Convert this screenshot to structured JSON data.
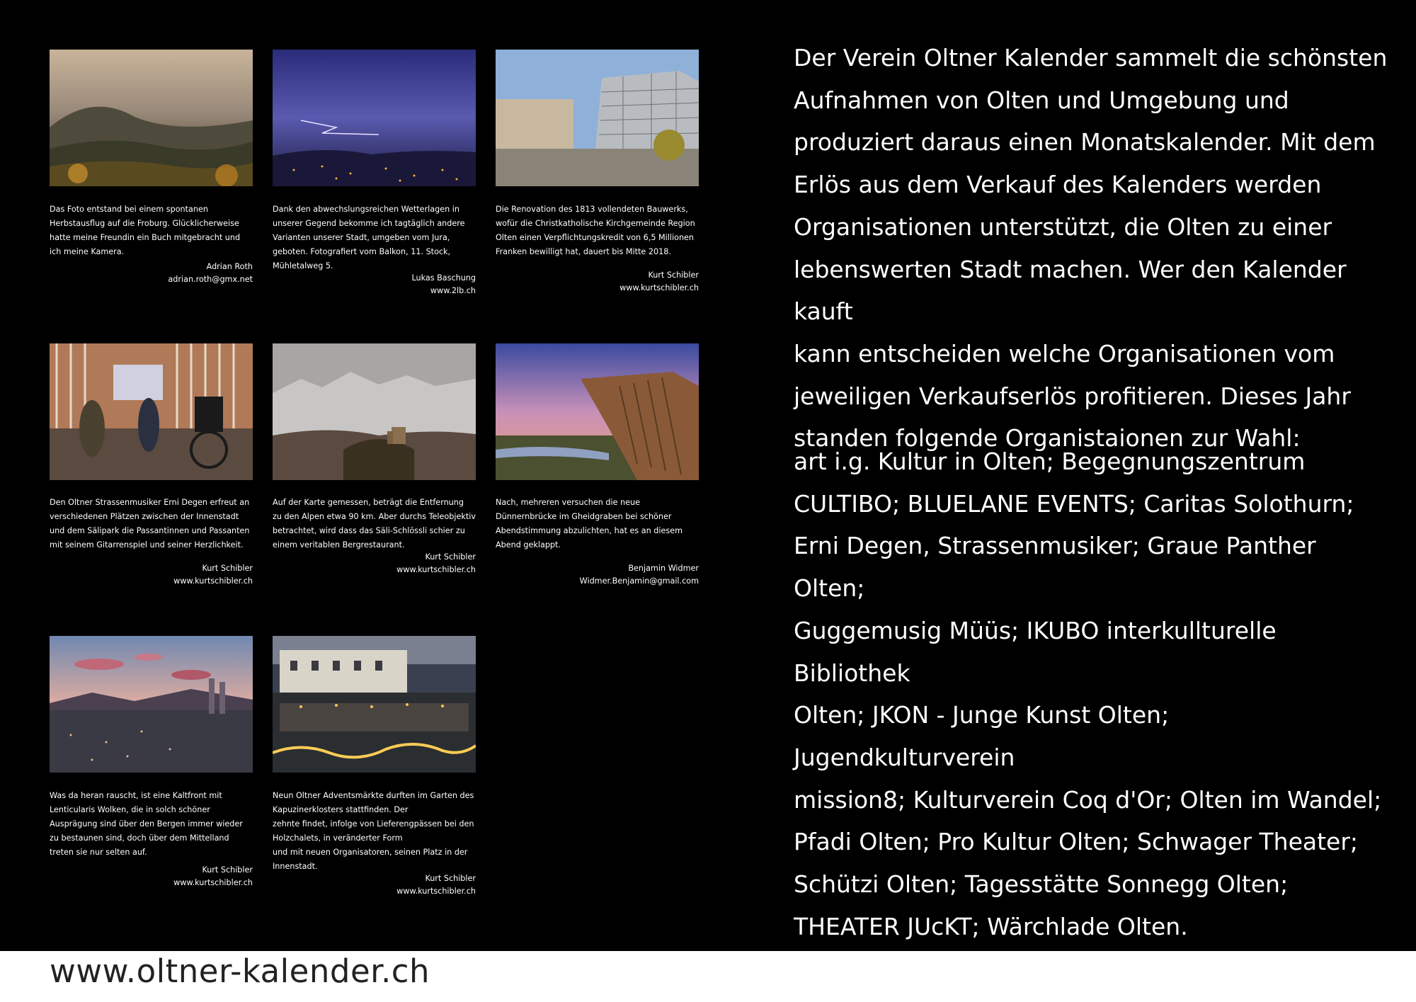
{
  "photos": [
    {
      "text": "Das Foto entstand bei einem spontanen\nHerbstausflug auf die Froburg. Glücklicherweise\nhatte meine Freundin ein Buch mitgebracht und\nich meine Kamera.",
      "author": "Adrian Roth",
      "contact": "adrian.roth@gmx.net"
    },
    {
      "text": "Dank den abwechslungsreichen Wetterlagen in\nunserer Gegend bekomme ich tagtäglich andere\nVarianten unserer Stadt, umgeben vom Jura,\ngeboten. Fotografiert vom Balkon, 11. Stock,\nMühletalweg 5.",
      "author": "Lukas Baschung",
      "contact": "www.2lb.ch"
    },
    {
      "text": "Die Renovation des 1813 vollendeten Bauwerks,\nwofür die Christkatholische Kirchgemeinde Region\nOlten einen Verpflichtungskredit von 6,5 Millionen\nFranken bewilligt hat, dauert  bis Mitte 2018.",
      "author": "Kurt Schibler",
      "contact": "www.kurtschibler.ch"
    },
    {
      "text": "Den Oltner Strassenmusiker Erni Degen erfreut an\nverschiedenen Plätzen zwischen der Innenstadt\nund dem Sälipark die Passantinnen und Passanten\nmit seinem Gitarrenspiel und seiner Herzlichkeit.",
      "author": "Kurt Schibler",
      "contact": "www.kurtschibler.ch"
    },
    {
      "text": "Auf der Karte gemessen, beträgt die Entfernung\nzu den Alpen etwa 90 km. Aber durchs Teleobjektiv\nbetrachtet, wird dass das Säli-Schlössli schier zu\neinem veritablen Bergrestaurant.",
      "author": "Kurt Schibler",
      "contact": "www.kurtschibler.ch"
    },
    {
      "text": "Nach, mehreren versuchen die neue\nDünnernbrücke im Gheidgraben bei schöner\nAbendstimmung abzulichten, hat es an diesem\nAbend geklappt.",
      "author": "Benjamin Widmer",
      "contact": "Widmer.Benjamin@gmail.com"
    },
    {
      "text": "Was da heran rauscht, ist eine Kaltfront mit\nLenticularis Wolken, die in solch schöner\nAusprägung sind über den Bergen immer wieder\nzu bestaunen sind, doch über dem Mittelland\ntreten sie nur selten auf.",
      "author": "Kurt Schibler",
      "contact": "www.kurtschibler.ch"
    },
    {
      "text": "Neun Oltner Adventsmärkte durften im Garten des\nKapuzinerklosters stattfinden. Der\nzehnte findet, infolge von Lieferengpässen bei den\nHolzchalets, in veränderter Form\nund mit neuen Organisatoren, seinen Platz in der\nInnenstadt.",
      "author": "Kurt Schibler",
      "contact": "www.kurtschibler.ch"
    }
  ],
  "intro": "Der Verein Oltner Kalender sammelt die schönsten\nAufnahmen von Olten und Umgebung und\nproduziert daraus einen Monatskalender. Mit dem\nErlös aus dem Verkauf des Kalenders werden\nOrganisationen unterstützt, die Olten zu einer\nlebenswerten Stadt machen. Wer den Kalender kauft\nkann entscheiden welche Organisationen vom\njeweiligen Verkaufserlös profitieren.  Dieses Jahr\nstanden folgende Organistaionen zur Wahl:",
  "organisations": "art i.g. Kultur in Olten; Begegnungszentrum\nCULTIBO; BLUELANE EVENTS; Caritas Solothurn;\nErni Degen, Strassenmusiker; Graue Panther Olten;\nGuggemusig Müüs; IKUBO interkullturelle Bibliothek\nOlten; JKON - Junge Kunst Olten; Jugendkulturverein\nmission8; Kulturverein Coq d'Or; Olten im Wandel;\nPfadi Olten; Pro Kultur Olten; Schwager Theater;\nSchützi Olten; Tagesstätte Sonnegg Olten;\nTHEATER JUcKT; Wärchlade Olten.",
  "footer": {
    "url": "www.oltner-kalender.ch"
  }
}
